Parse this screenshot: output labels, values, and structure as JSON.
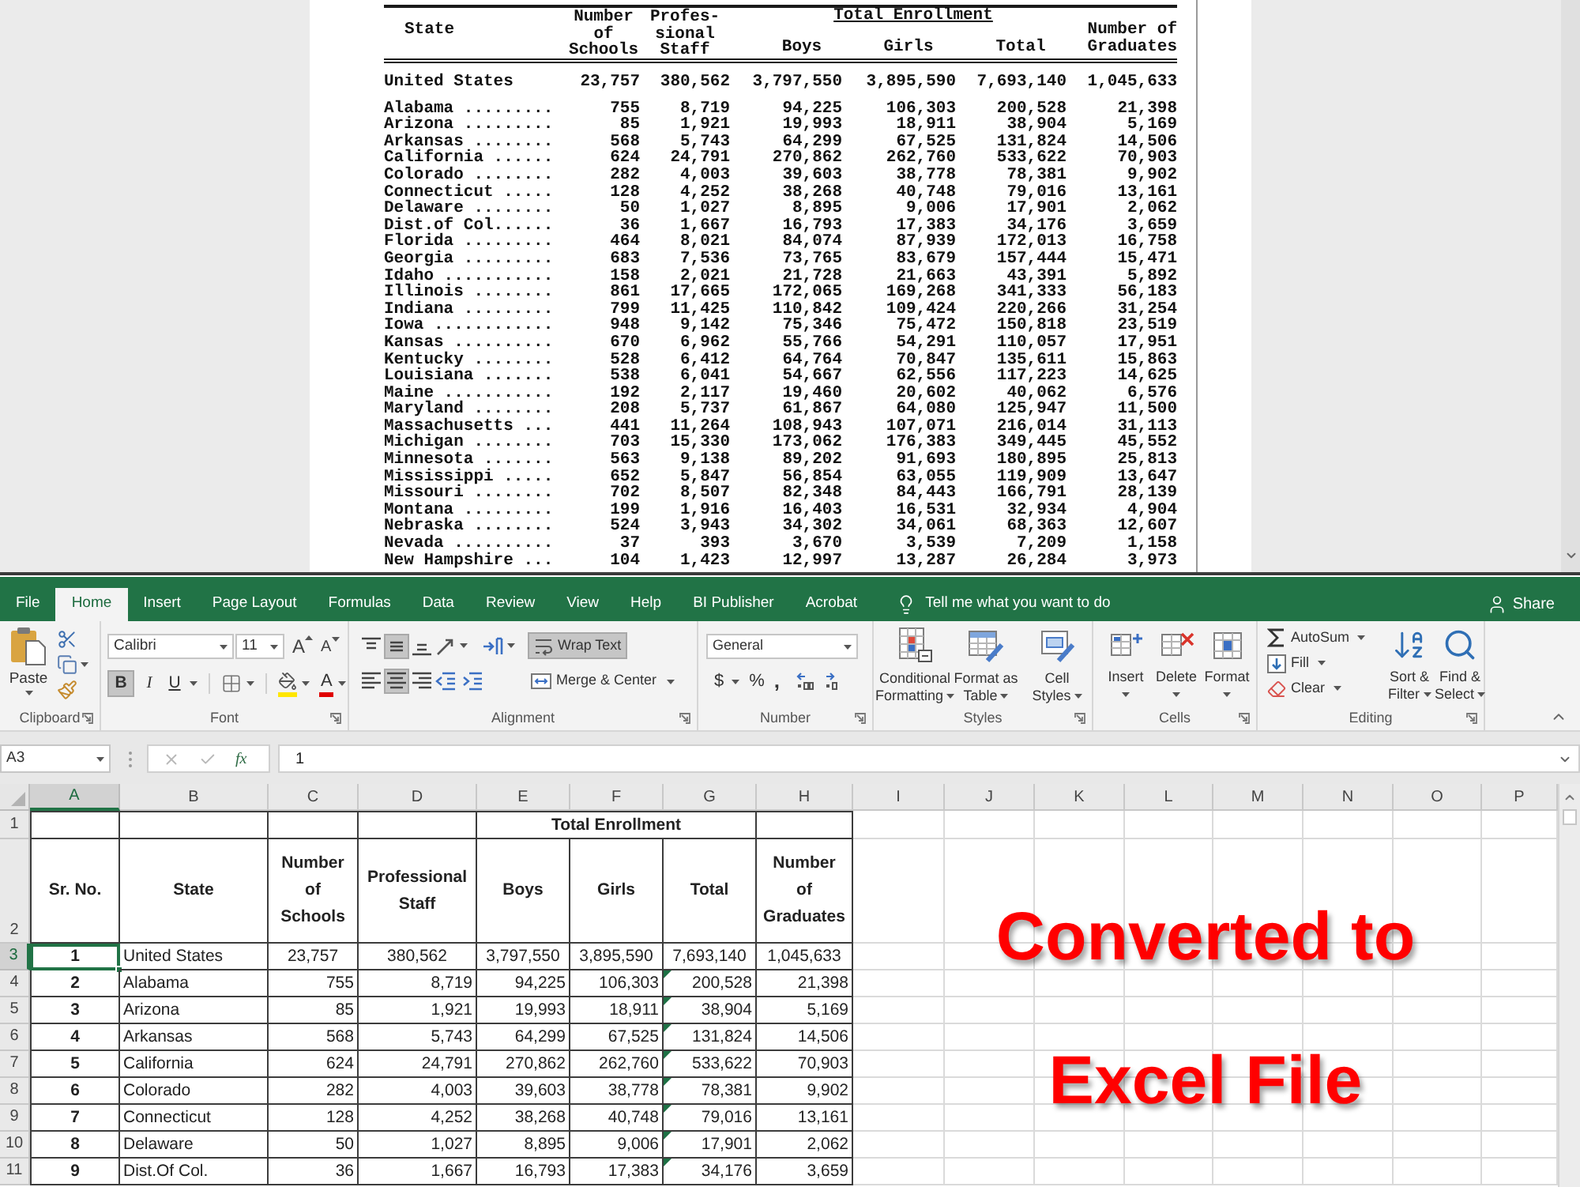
{
  "viewer": {
    "header": {
      "state": "State",
      "schools": [
        "Number",
        "of",
        "Schools"
      ],
      "staff": [
        "Profes-",
        "sional",
        "Staff"
      ],
      "enrollment": "Total Enrollment",
      "boys": "Boys",
      "girls": "Girls",
      "total": "Total",
      "graduates": [
        "Number of",
        "Graduates"
      ]
    },
    "rows": [
      {
        "kind": "total",
        "cells": [
          "United States",
          "23,757",
          "380,562",
          "3,797,550",
          "3,895,590",
          "7,693,140",
          "1,045,633"
        ]
      },
      {
        "kind": "state",
        "cells": [
          "Alabama .........",
          "755",
          "8,719",
          "94,225",
          "106,303",
          "200,528",
          "21,398"
        ]
      },
      {
        "kind": "state",
        "cells": [
          "Arizona .........",
          "85",
          "1,921",
          "19,993",
          "18,911",
          "38,904",
          "5,169"
        ]
      },
      {
        "kind": "state",
        "cells": [
          "Arkansas ........",
          "568",
          "5,743",
          "64,299",
          "67,525",
          "131,824",
          "14,506"
        ]
      },
      {
        "kind": "state",
        "cells": [
          "California ......",
          "624",
          "24,791",
          "270,862",
          "262,760",
          "533,622",
          "70,903"
        ]
      },
      {
        "kind": "state",
        "cells": [
          "Colorado ........",
          "282",
          "4,003",
          "39,603",
          "38,778",
          "78,381",
          "9,902"
        ]
      },
      {
        "kind": "state",
        "cells": [
          "Connecticut .....",
          "128",
          "4,252",
          "38,268",
          "40,748",
          "79,016",
          "13,161"
        ]
      },
      {
        "kind": "state",
        "cells": [
          "Delaware ........",
          "50",
          "1,027",
          "8,895",
          "9,006",
          "17,901",
          "2,062"
        ]
      },
      {
        "kind": "state",
        "cells": [
          "Dist.of Col......",
          "36",
          "1,667",
          "16,793",
          "17,383",
          "34,176",
          "3,659"
        ]
      },
      {
        "kind": "state",
        "cells": [
          "Florida .........",
          "464",
          "8,021",
          "84,074",
          "87,939",
          "172,013",
          "16,758"
        ]
      },
      {
        "kind": "state",
        "cells": [
          "Georgia .........",
          "683",
          "7,536",
          "73,765",
          "83,679",
          "157,444",
          "15,471"
        ]
      },
      {
        "kind": "state",
        "cells": [
          "Idaho ...........",
          "158",
          "2,021",
          "21,728",
          "21,663",
          "43,391",
          "5,892"
        ]
      },
      {
        "kind": "state",
        "cells": [
          "Illinois ........",
          "861",
          "17,665",
          "172,065",
          "169,268",
          "341,333",
          "56,183"
        ]
      },
      {
        "kind": "state",
        "cells": [
          "Indiana .........",
          "799",
          "11,425",
          "110,842",
          "109,424",
          "220,266",
          "31,254"
        ]
      },
      {
        "kind": "state",
        "cells": [
          "Iowa ............",
          "948",
          "9,142",
          "75,346",
          "75,472",
          "150,818",
          "23,519"
        ]
      },
      {
        "kind": "state",
        "cells": [
          "Kansas ..........",
          "670",
          "6,962",
          "55,766",
          "54,291",
          "110,057",
          "17,951"
        ]
      },
      {
        "kind": "state",
        "cells": [
          "Kentucky ........",
          "528",
          "6,412",
          "64,764",
          "70,847",
          "135,611",
          "15,863"
        ]
      },
      {
        "kind": "state",
        "cells": [
          "Louisiana .......",
          "538",
          "6,041",
          "54,667",
          "62,556",
          "117,223",
          "14,625"
        ]
      },
      {
        "kind": "state",
        "cells": [
          "Maine ...........",
          "192",
          "2,117",
          "19,460",
          "20,602",
          "40,062",
          "6,576"
        ]
      },
      {
        "kind": "state",
        "cells": [
          "Maryland ........",
          "208",
          "5,737",
          "61,867",
          "64,080",
          "125,947",
          "11,500"
        ]
      },
      {
        "kind": "state",
        "cells": [
          "Massachusetts ...",
          "441",
          "11,264",
          "108,943",
          "107,071",
          "216,014",
          "31,113"
        ]
      },
      {
        "kind": "state",
        "cells": [
          "Michigan ........",
          "703",
          "15,330",
          "173,062",
          "176,383",
          "349,445",
          "45,552"
        ]
      },
      {
        "kind": "state",
        "cells": [
          "Minnesota .......",
          "563",
          "9,138",
          "89,202",
          "91,693",
          "180,895",
          "25,813"
        ]
      },
      {
        "kind": "state",
        "cells": [
          "Mississippi .....",
          "652",
          "5,847",
          "56,854",
          "63,055",
          "119,909",
          "13,647"
        ]
      },
      {
        "kind": "state",
        "cells": [
          "Missouri ........",
          "702",
          "8,507",
          "82,348",
          "84,443",
          "166,791",
          "28,139"
        ]
      },
      {
        "kind": "state",
        "cells": [
          "Montana .........",
          "199",
          "1,916",
          "16,403",
          "16,531",
          "32,934",
          "4,904"
        ]
      },
      {
        "kind": "state",
        "cells": [
          "Nebraska ........",
          "524",
          "3,943",
          "34,302",
          "34,061",
          "68,363",
          "12,607"
        ]
      },
      {
        "kind": "state",
        "cells": [
          "Nevada ..........",
          "37",
          "393",
          "3,670",
          "3,539",
          "7,209",
          "1,158"
        ]
      },
      {
        "kind": "state",
        "cells": [
          "New Hampshire ...",
          "104",
          "1,423",
          "12,997",
          "13,287",
          "26,284",
          "3,973"
        ]
      }
    ]
  },
  "excel": {
    "tabs": [
      {
        "label": "File",
        "selected": false
      },
      {
        "label": "Home",
        "selected": true
      },
      {
        "label": "Insert",
        "selected": false
      },
      {
        "label": "Page Layout",
        "selected": false
      },
      {
        "label": "Formulas",
        "selected": false
      },
      {
        "label": "Data",
        "selected": false
      },
      {
        "label": "Review",
        "selected": false
      },
      {
        "label": "View",
        "selected": false
      },
      {
        "label": "Help",
        "selected": false
      },
      {
        "label": "BI Publisher",
        "selected": false
      },
      {
        "label": "Acrobat",
        "selected": false
      }
    ],
    "tell_me": "Tell me what you want to do",
    "share": "Share",
    "ribbon": {
      "clipboard": {
        "paste": "Paste",
        "label": "Clipboard"
      },
      "font": {
        "name": "Calibri",
        "size": "11",
        "grow": "A",
        "shrink": "A",
        "bold": {
          "glyph": "B",
          "on": true
        },
        "italic": {
          "glyph": "I",
          "on": false
        },
        "underline": {
          "glyph": "U",
          "on": false
        },
        "color_glyph": "A",
        "label": "Font"
      },
      "alignment": {
        "vertical": [
          {
            "kind": "top",
            "selected": false
          },
          {
            "kind": "middle",
            "selected": true
          },
          {
            "kind": "bottom",
            "selected": false
          }
        ],
        "horizontal": [
          {
            "kind": "left",
            "selected": false
          },
          {
            "kind": "center",
            "selected": true
          },
          {
            "kind": "right",
            "selected": false
          }
        ],
        "wrap_text": {
          "label": "Wrap Text",
          "on": true
        },
        "merge": "Merge & Center",
        "label": "Alignment"
      },
      "number": {
        "format": "General",
        "currency": "$",
        "percent": "%",
        "comma": ",",
        "label": "Number"
      },
      "styles": {
        "buttons": [
          {
            "kind": "conditional",
            "lines": [
              "Conditional",
              "Formatting"
            ]
          },
          {
            "kind": "table",
            "lines": [
              "Format as",
              "Table"
            ]
          },
          {
            "kind": "cell",
            "lines": [
              "Cell",
              "Styles"
            ]
          }
        ],
        "label": "Styles"
      },
      "cells": {
        "buttons": [
          {
            "kind": "insert",
            "label": "Insert"
          },
          {
            "kind": "delete",
            "label": "Delete"
          },
          {
            "kind": "format",
            "label": "Format"
          }
        ],
        "label": "Cells"
      },
      "editing": {
        "small": [
          {
            "kind": "autosum",
            "label": "AutoSum"
          },
          {
            "kind": "fill",
            "label": "Fill"
          },
          {
            "kind": "clear",
            "label": "Clear"
          }
        ],
        "big": [
          {
            "kind": "sort",
            "lines": [
              "Sort &",
              "Filter"
            ]
          },
          {
            "kind": "find",
            "lines": [
              "Find &",
              "Select"
            ]
          }
        ],
        "label": "Editing"
      }
    },
    "formula_bar": {
      "name_box": "A3",
      "fx": "fx",
      "value": "1"
    },
    "sheet": {
      "columns": [
        {
          "label": "A",
          "selected": true
        },
        {
          "label": "B",
          "selected": false
        },
        {
          "label": "C",
          "selected": false
        },
        {
          "label": "D",
          "selected": false
        },
        {
          "label": "E",
          "selected": false
        },
        {
          "label": "F",
          "selected": false
        },
        {
          "label": "G",
          "selected": false
        },
        {
          "label": "H",
          "selected": false
        },
        {
          "label": "I",
          "selected": false
        },
        {
          "label": "J",
          "selected": false
        },
        {
          "label": "K",
          "selected": false
        },
        {
          "label": "L",
          "selected": false
        },
        {
          "label": "M",
          "selected": false
        },
        {
          "label": "N",
          "selected": false
        },
        {
          "label": "O",
          "selected": false
        },
        {
          "label": "P",
          "selected": false
        }
      ],
      "title_row": {
        "number": "1",
        "selected": false,
        "label": "Total Enrollment"
      },
      "header_row": {
        "number": "2",
        "selected": false,
        "cells": [
          [
            "Sr. No."
          ],
          [
            "State"
          ],
          [
            "Number",
            "of",
            "Schools"
          ],
          [
            "Professional",
            "Staff"
          ],
          [
            "Boys"
          ],
          [
            "Girls"
          ],
          [
            "Total"
          ],
          [
            "Number",
            "of",
            "Graduates"
          ]
        ]
      },
      "rows": [
        {
          "number": "3",
          "selected": true,
          "kind": "total",
          "error_indicator": false,
          "cells": [
            "1",
            "United States",
            "23,757",
            "380,562",
            "3,797,550",
            "3,895,590",
            "7,693,140",
            "1,045,633"
          ]
        },
        {
          "number": "4",
          "selected": false,
          "kind": "state",
          "error_indicator": true,
          "cells": [
            "2",
            "Alabama",
            "755",
            "8,719",
            "94,225",
            "106,303",
            "200,528",
            "21,398"
          ]
        },
        {
          "number": "5",
          "selected": false,
          "kind": "state",
          "error_indicator": true,
          "cells": [
            "3",
            "Arizona",
            "85",
            "1,921",
            "19,993",
            "18,911",
            "38,904",
            "5,169"
          ]
        },
        {
          "number": "6",
          "selected": false,
          "kind": "state",
          "error_indicator": true,
          "cells": [
            "4",
            "Arkansas",
            "568",
            "5,743",
            "64,299",
            "67,525",
            "131,824",
            "14,506"
          ]
        },
        {
          "number": "7",
          "selected": false,
          "kind": "state",
          "error_indicator": true,
          "cells": [
            "5",
            "California",
            "624",
            "24,791",
            "270,862",
            "262,760",
            "533,622",
            "70,903"
          ]
        },
        {
          "number": "8",
          "selected": false,
          "kind": "state",
          "error_indicator": true,
          "cells": [
            "6",
            "Colorado",
            "282",
            "4,003",
            "39,603",
            "38,778",
            "78,381",
            "9,902"
          ]
        },
        {
          "number": "9",
          "selected": false,
          "kind": "state",
          "error_indicator": true,
          "cells": [
            "7",
            "Connecticut",
            "128",
            "4,252",
            "38,268",
            "40,748",
            "79,016",
            "13,161"
          ]
        },
        {
          "number": "10",
          "selected": false,
          "kind": "state",
          "error_indicator": true,
          "cells": [
            "8",
            "Delaware",
            "50",
            "1,027",
            "8,895",
            "9,006",
            "17,901",
            "2,062"
          ]
        },
        {
          "number": "11",
          "selected": false,
          "kind": "state",
          "error_indicator": true,
          "cells": [
            "9",
            "Dist.Of Col.",
            "36",
            "1,667",
            "16,793",
            "17,383",
            "34,176",
            "3,659"
          ]
        }
      ]
    },
    "annotation": [
      "Converted to",
      "Excel File"
    ]
  }
}
